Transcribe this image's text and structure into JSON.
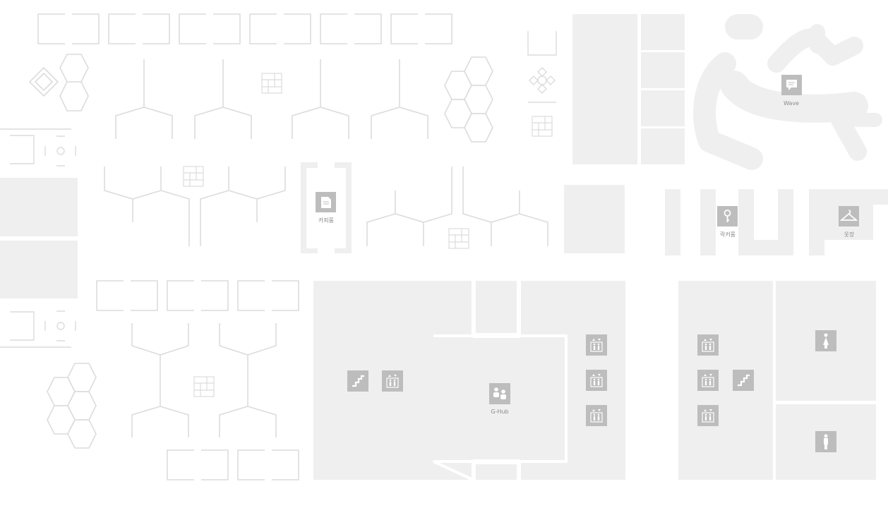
{
  "map": {
    "colors": {
      "background": "#ffffff",
      "room_fill": "#efefef",
      "line": "#dcdcdc",
      "icon_bg": "#bdbdbd",
      "icon_fg": "#ffffff",
      "label": "#8a8a8a"
    },
    "poi": {
      "wave": {
        "label": "Wave",
        "icon": "chat-bubble-icon"
      },
      "cafe_room": {
        "label": "카피룸",
        "icon": "document-icon"
      },
      "locker_room": {
        "label": "락커룸",
        "icon": "key-icon"
      },
      "wardrobe": {
        "label": "옷장",
        "icon": "hanger-icon"
      },
      "ghub": {
        "label": "G-Hub",
        "icon": "meeting-people-icon"
      }
    },
    "facilities": [
      {
        "type": "stairs",
        "icon": "stairs-icon"
      },
      {
        "type": "elevator",
        "icon": "elevator-icon"
      },
      {
        "type": "restroom-female",
        "icon": "female-restroom-icon"
      },
      {
        "type": "restroom-male",
        "icon": "male-restroom-icon"
      }
    ]
  }
}
